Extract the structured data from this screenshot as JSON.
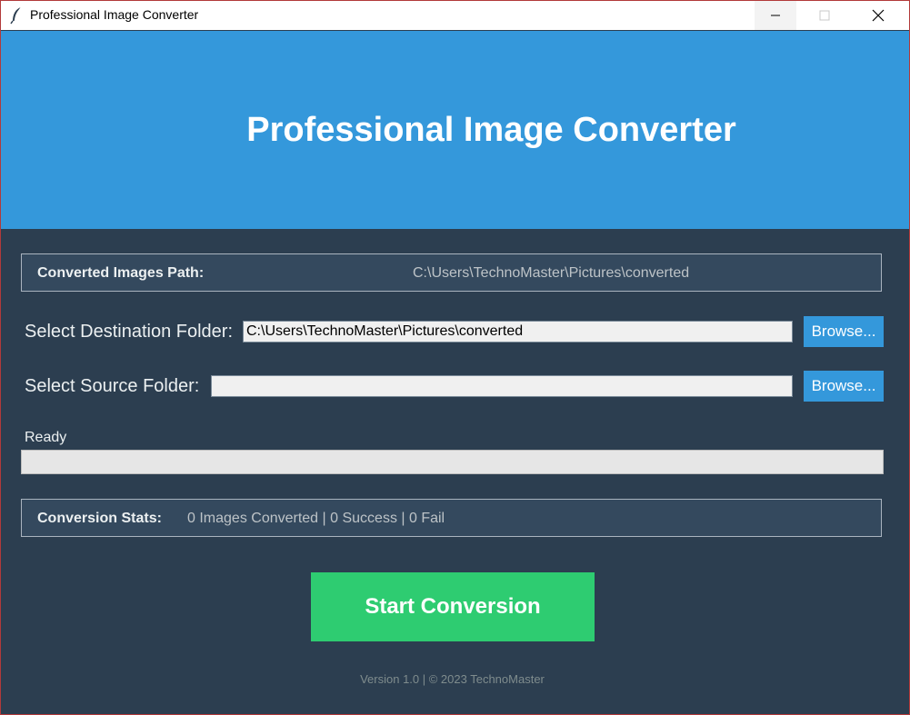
{
  "window": {
    "title": "Professional Image Converter",
    "controls": [
      "minimize",
      "maximize",
      "close"
    ]
  },
  "header": {
    "title": "Professional Image Converter"
  },
  "converted_path": {
    "label": "Converted Images Path:",
    "value": "C:\\Users\\TechnoMaster\\Pictures\\converted"
  },
  "destination": {
    "label": "Select Destination Folder:",
    "value": "C:\\Users\\TechnoMaster\\Pictures\\converted",
    "browse_label": "Browse..."
  },
  "source": {
    "label": "Select Source Folder:",
    "value": "",
    "browse_label": "Browse..."
  },
  "progress": {
    "status": "Ready",
    "fraction": 0
  },
  "stats": {
    "label": "Conversion Stats:",
    "value": "0 Images Converted | 0 Success | 0 Fail"
  },
  "start_button": {
    "label": "Start Conversion"
  },
  "footer": {
    "text": "Version 1.0 | © 2023 TechnoMaster"
  },
  "colors": {
    "header_bg": "#3498db",
    "body_bg": "#2c3e50",
    "panel_bg": "#34495e",
    "button_blue": "#3498db",
    "start_green": "#2ecc71"
  },
  "icons": {
    "app": "feather-icon",
    "minimize": "minimize-icon",
    "maximize": "maximize-icon",
    "close": "close-icon"
  }
}
